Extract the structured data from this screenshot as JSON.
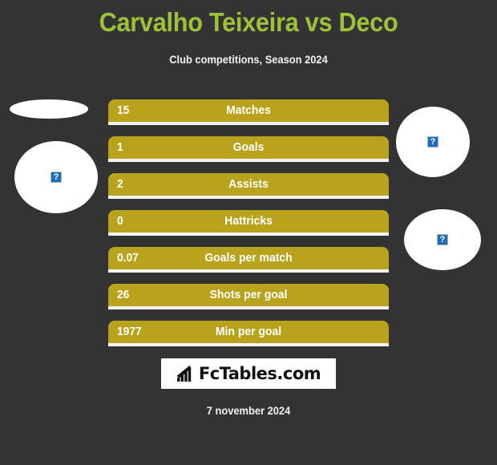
{
  "header": {
    "title": "Carvalho Teixeira vs Deco",
    "subtitle": "Club competitions, Season 2024",
    "title_color": "#9dc238",
    "background_color": "#333333"
  },
  "players": {
    "left": {
      "avatar_top_icon": "broken-image-icon",
      "avatar_main_icon": "broken-image-icon",
      "placeholder_glyph": "?"
    },
    "right": {
      "avatar_top_icon": "broken-image-icon",
      "avatar_main_icon": "broken-image-icon",
      "placeholder_glyph": "?"
    }
  },
  "stats": {
    "bar_color": "#b9a31c",
    "rows": [
      {
        "value": "15",
        "label": "Matches"
      },
      {
        "value": "1",
        "label": "Goals"
      },
      {
        "value": "2",
        "label": "Assists"
      },
      {
        "value": "0",
        "label": "Hattricks"
      },
      {
        "value": "0.07",
        "label": "Goals per match"
      },
      {
        "value": "26",
        "label": "Shots per goal"
      },
      {
        "value": "1977",
        "label": "Min per goal"
      }
    ]
  },
  "footer": {
    "logo_text": "FcTables.com",
    "logo_icon": "bar-chart-icon",
    "date": "7 november 2024"
  },
  "chart_data": {
    "type": "bar",
    "title": "Carvalho Teixeira vs Deco",
    "subtitle": "Club competitions, Season 2024",
    "categories": [
      "Matches",
      "Goals",
      "Assists",
      "Hattricks",
      "Goals per match",
      "Shots per goal",
      "Min per goal"
    ],
    "values": [
      15,
      1,
      2,
      0,
      0.07,
      26,
      1977
    ],
    "value_labels": [
      "15",
      "1",
      "2",
      "0",
      "0.07",
      "26",
      "1977"
    ],
    "series": [
      {
        "name": "Carvalho Teixeira",
        "values": [
          15,
          1,
          2,
          0,
          0.07,
          26,
          1977
        ]
      }
    ],
    "xlabel": "",
    "ylabel": "",
    "grid": false,
    "legend": "none",
    "orientation": "horizontal",
    "bar_color": "#b9a31c"
  }
}
